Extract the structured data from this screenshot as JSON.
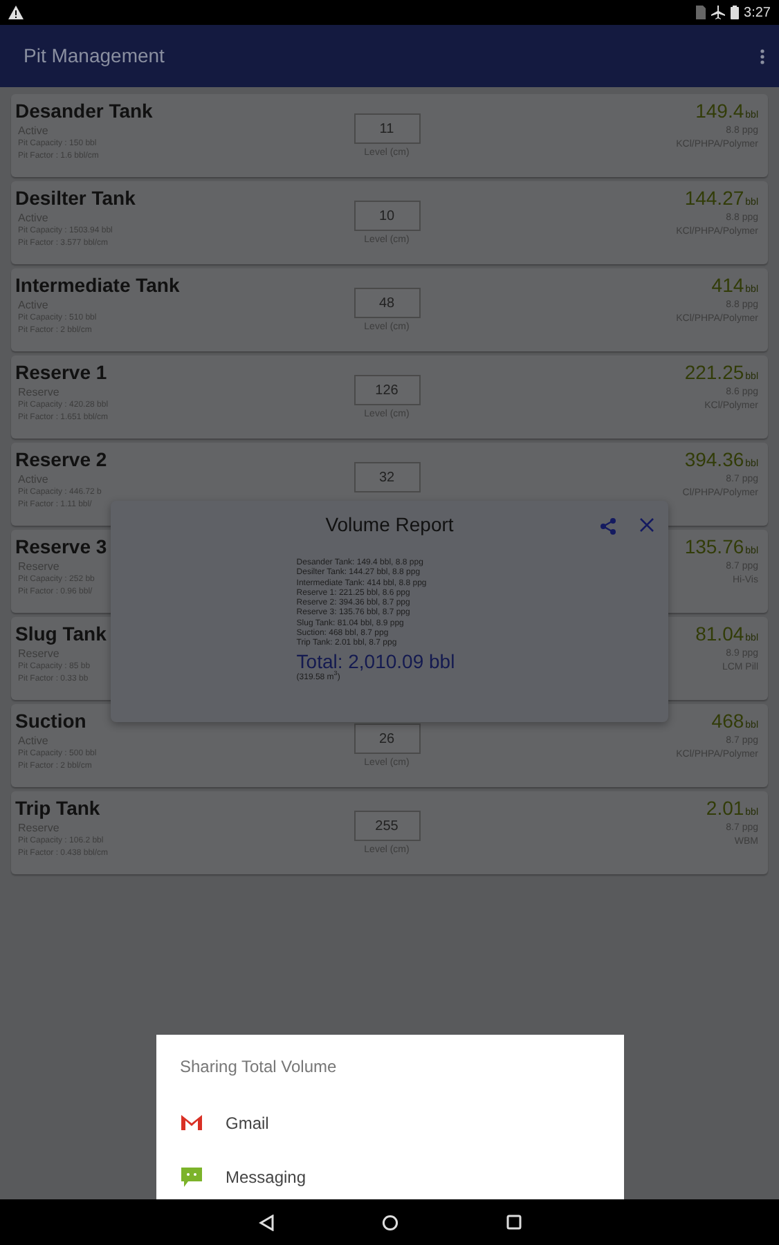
{
  "status_bar": {
    "time": "3:27"
  },
  "app_bar": {
    "title": "Pit Management"
  },
  "tanks": [
    {
      "name": "Desander Tank",
      "status": "Active",
      "capacity": "Pit Capacity : 150 bbl",
      "factor": "Pit Factor : 1.6 bbl/cm",
      "level_value": "11",
      "level_label": "Level (cm)",
      "volume": "149.4",
      "unit": "bbl",
      "density": "8.8 ppg",
      "fluid": "KCl/PHPA/Polymer"
    },
    {
      "name": "Desilter Tank",
      "status": "Active",
      "capacity": "Pit Capacity : 1503.94 bbl",
      "factor": "Pit Factor : 3.577 bbl/cm",
      "level_value": "10",
      "level_label": "Level (cm)",
      "volume": "144.27",
      "unit": "bbl",
      "density": "8.8 ppg",
      "fluid": "KCl/PHPA/Polymer"
    },
    {
      "name": "Intermediate Tank",
      "status": "Active",
      "capacity": "Pit Capacity : 510 bbl",
      "factor": "Pit Factor : 2 bbl/cm",
      "level_value": "48",
      "level_label": "Level (cm)",
      "volume": "414",
      "unit": "bbl",
      "density": "8.8 ppg",
      "fluid": "KCl/PHPA/Polymer"
    },
    {
      "name": "Reserve 1",
      "status": "Reserve",
      "capacity": "Pit Capacity : 420.28 bbl",
      "factor": "Pit Factor : 1.651 bbl/cm",
      "level_value": "126",
      "level_label": "Level (cm)",
      "volume": "221.25",
      "unit": "bbl",
      "density": "8.6 ppg",
      "fluid": "KCl/Polymer"
    },
    {
      "name": "Reserve 2",
      "status": "Active",
      "capacity": "Pit Capacity : 446.72 b",
      "factor": "Pit Factor : 1.11 bbl/",
      "level_value": "32",
      "volume": "394.36",
      "unit": "bbl",
      "density": "8.7 ppg",
      "fluid": "Cl/PHPA/Polymer"
    },
    {
      "name": "Reserve 3",
      "status": "Reserve",
      "capacity": "Pit Capacity : 252 bb",
      "factor": "Pit Factor : 0.96 bbl/",
      "volume": "135.76",
      "unit": "bbl",
      "density": "8.7 ppg",
      "fluid": "Hi-Vis"
    },
    {
      "name": "Slug Tank",
      "status": "Reserve",
      "capacity": "Pit Capacity : 85 bb",
      "factor": "Pit Factor : 0.33 bb",
      "volume": "81.04",
      "unit": "bbl",
      "density": "8.9 ppg",
      "fluid": "LCM Pill"
    },
    {
      "name": "Suction",
      "status": "Active",
      "capacity": "Pit Capacity : 500 bbl",
      "factor": "Pit Factor : 2 bbl/cm",
      "level_value": "26",
      "level_label": "Level (cm)",
      "volume": "468",
      "unit": "bbl",
      "density": "8.7 ppg",
      "fluid": "KCl/PHPA/Polymer"
    },
    {
      "name": "Trip Tank",
      "status": "Reserve",
      "capacity": "Pit Capacity : 106.2 bbl",
      "factor": "Pit Factor : 0.438 bbl/cm",
      "level_value": "255",
      "level_label": "Level (cm)",
      "volume": "2.01",
      "unit": "bbl",
      "density": "8.7 ppg",
      "fluid": "WBM"
    }
  ],
  "volume_report": {
    "title": "Volume Report",
    "lines": [
      "Desander Tank: 149.4 bbl, 8.8 ppg",
      "Desilter Tank: 144.27 bbl, 8.8 ppg",
      "Intermediate Tank: 414 bbl, 8.8 ppg",
      "Reserve 1: 221.25 bbl, 8.6 ppg",
      "Reserve 2: 394.36 bbl, 8.7 ppg",
      "Reserve 3: 135.76 bbl, 8.7 ppg",
      "Slug Tank: 81.04 bbl, 8.9 ppg",
      "Suction: 468 bbl, 8.7 ppg",
      "Trip Tank: 2.01 bbl, 8.7 ppg"
    ],
    "total": "Total: 2,010.09 bbl",
    "total_metric": "(319.58 m$^{3}$)"
  },
  "share_sheet": {
    "title": "Sharing Total Volume",
    "apps": [
      {
        "label": "Gmail",
        "kind": "mail"
      },
      {
        "label": "Messaging",
        "kind": "chat"
      }
    ]
  }
}
